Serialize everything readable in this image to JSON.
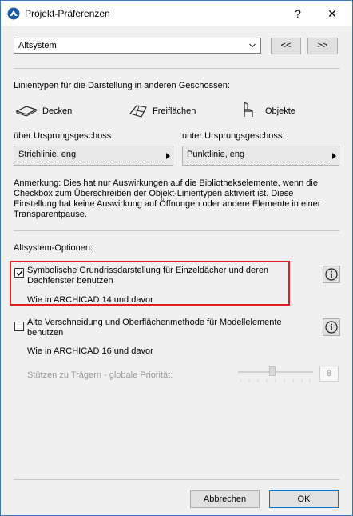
{
  "window": {
    "title": "Projekt-Präferenzen",
    "help": "?",
    "close": "✕"
  },
  "top": {
    "dropdown_value": "Altsystem",
    "prev_label": "<<",
    "next_label": ">>"
  },
  "linetypes": {
    "heading": "Linientypen für die Darstellung in anderen Geschossen:",
    "decken": "Decken",
    "freiflaechen": "Freiflächen",
    "objekte": "Objekte",
    "above_label": "über Ursprungsgeschoss:",
    "above_value": "Strichlinie, eng",
    "below_label": "unter Ursprungsgeschoss:",
    "below_value": "Punktlinie, eng",
    "note": "Anmerkung: Dies hat nur Auswirkungen auf die Bibliothekselemente, wenn die Checkbox zum Überschreiben der Objekt-Linientypen aktiviert ist. Diese Einstellung hat keine Auswirkung auf Öffnungen oder andere Elemente in einer Transparentpause."
  },
  "options": {
    "heading": "Altsystem-Optionen:",
    "opt1_label": "Symbolische Grundrissdarstellung für Einzeldächer und deren Dachfenster benutzen",
    "opt1_checked": true,
    "opt1_sub": "Wie in ARCHICAD 14 und davor",
    "opt2_label": "Alte Verschneidung und Oberflächenmethode für Modellelemente benutzen",
    "opt2_checked": false,
    "opt2_sub": "Wie in ARCHICAD 16 und davor",
    "priority_label": "Stützen zu Trägern - globale Priorität:",
    "priority_value": "8",
    "highlight_color": "#e02020"
  },
  "footer": {
    "cancel": "Abbrechen",
    "ok": "OK"
  }
}
